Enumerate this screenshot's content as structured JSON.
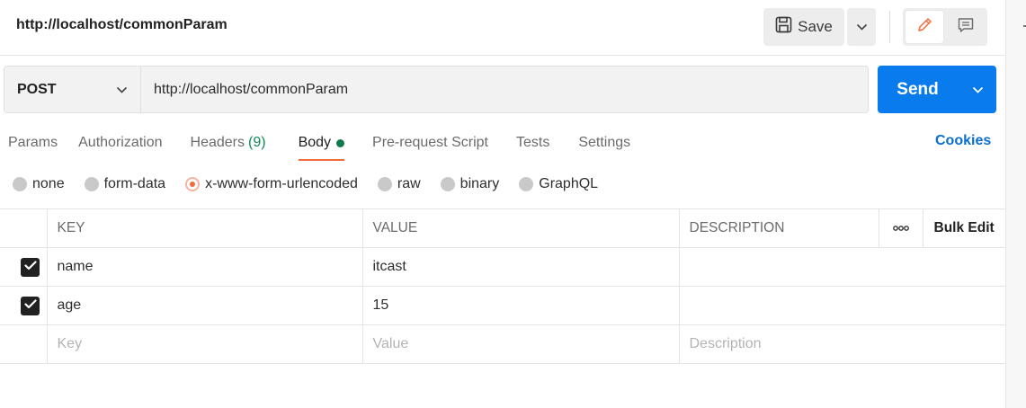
{
  "request": {
    "name": "http://localhost/commonParam",
    "method": "POST",
    "url": "http://localhost/commonParam"
  },
  "toolbar": {
    "save_label": "Save",
    "send_label": "Send"
  },
  "tabs": [
    {
      "label": "Params",
      "active": false
    },
    {
      "label": "Authorization",
      "active": false
    },
    {
      "label": "Headers",
      "count": "(9)",
      "active": false
    },
    {
      "label": "Body",
      "active": true,
      "indicator": "green-dot"
    },
    {
      "label": "Pre-request Script",
      "active": false
    },
    {
      "label": "Tests",
      "active": false
    },
    {
      "label": "Settings",
      "active": false
    }
  ],
  "cookies_label": "Cookies",
  "body_types": [
    {
      "label": "none",
      "selected": false
    },
    {
      "label": "form-data",
      "selected": false
    },
    {
      "label": "x-www-form-urlencoded",
      "selected": true
    },
    {
      "label": "raw",
      "selected": false
    },
    {
      "label": "binary",
      "selected": false
    },
    {
      "label": "GraphQL",
      "selected": false
    }
  ],
  "table": {
    "headers": {
      "key": "KEY",
      "value": "VALUE",
      "description": "DESCRIPTION",
      "more": "ooo",
      "bulk_edit": "Bulk Edit"
    },
    "rows": [
      {
        "checked": true,
        "key": "name",
        "value": "itcast",
        "description": ""
      },
      {
        "checked": true,
        "key": "age",
        "value": "15",
        "description": ""
      }
    ],
    "placeholders": {
      "key": "Key",
      "value": "Value",
      "description": "Description"
    }
  },
  "colors": {
    "send": "#097bed",
    "active_tab_underline": "#f26b3a",
    "body_dot": "#0e7a4a",
    "cookies_link": "#0b6fcf",
    "headers_count": "#0e8a55"
  },
  "icons": [
    "save-icon",
    "chevron-down-icon",
    "pencil-icon",
    "comment-icon",
    "checkmark-icon",
    "more-icon"
  ]
}
